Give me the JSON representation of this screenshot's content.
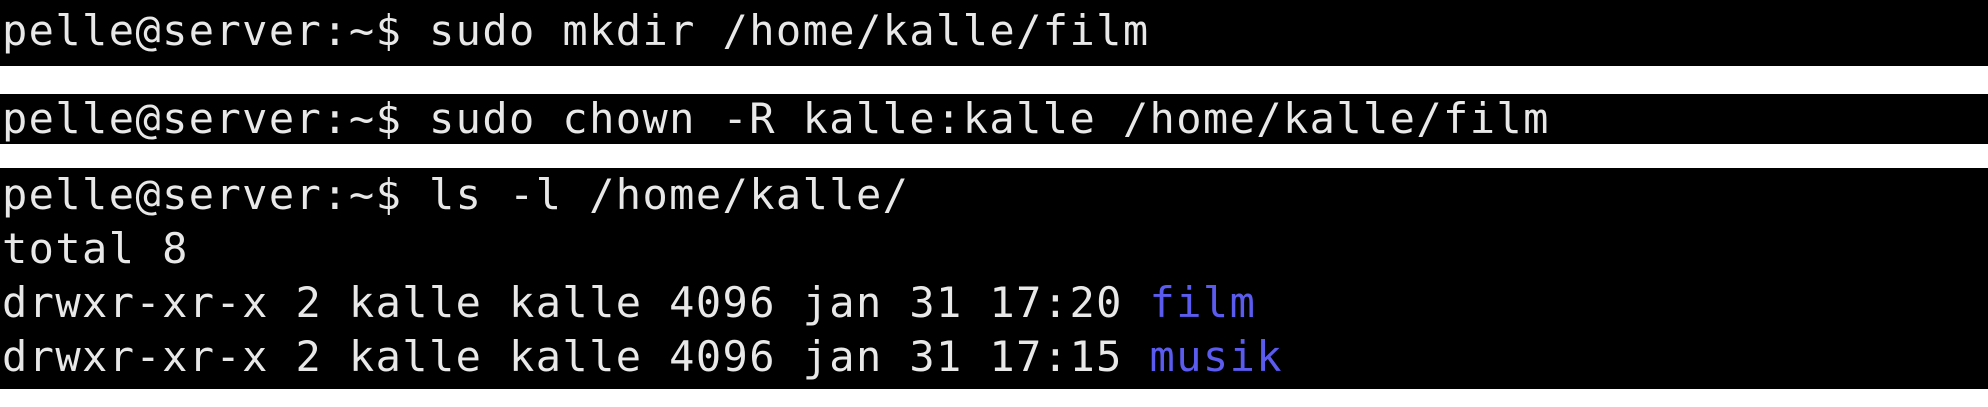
{
  "blocks": [
    {
      "prompt": "pelle@server:~$ ",
      "command": "sudo mkdir /home/kalle/film"
    },
    {
      "prompt": "pelle@server:~$ ",
      "command": "sudo chown -R kalle:kalle /home/kalle/film"
    },
    {
      "prompt": "pelle@server:~$ ",
      "command": "ls -l /home/kalle/",
      "output": {
        "total": "total 8",
        "entries": [
          {
            "meta": "drwxr-xr-x 2 kalle kalle 4096 jan 31 17:20 ",
            "name": "film"
          },
          {
            "meta": "drwxr-xr-x 2 kalle kalle 4096 jan 31 17:15 ",
            "name": "musik"
          }
        ]
      }
    }
  ],
  "colors": {
    "terminal_bg": "#000000",
    "text": "#e8e8e8",
    "directory": "#5b5bf0",
    "gap": "#ffffff"
  }
}
